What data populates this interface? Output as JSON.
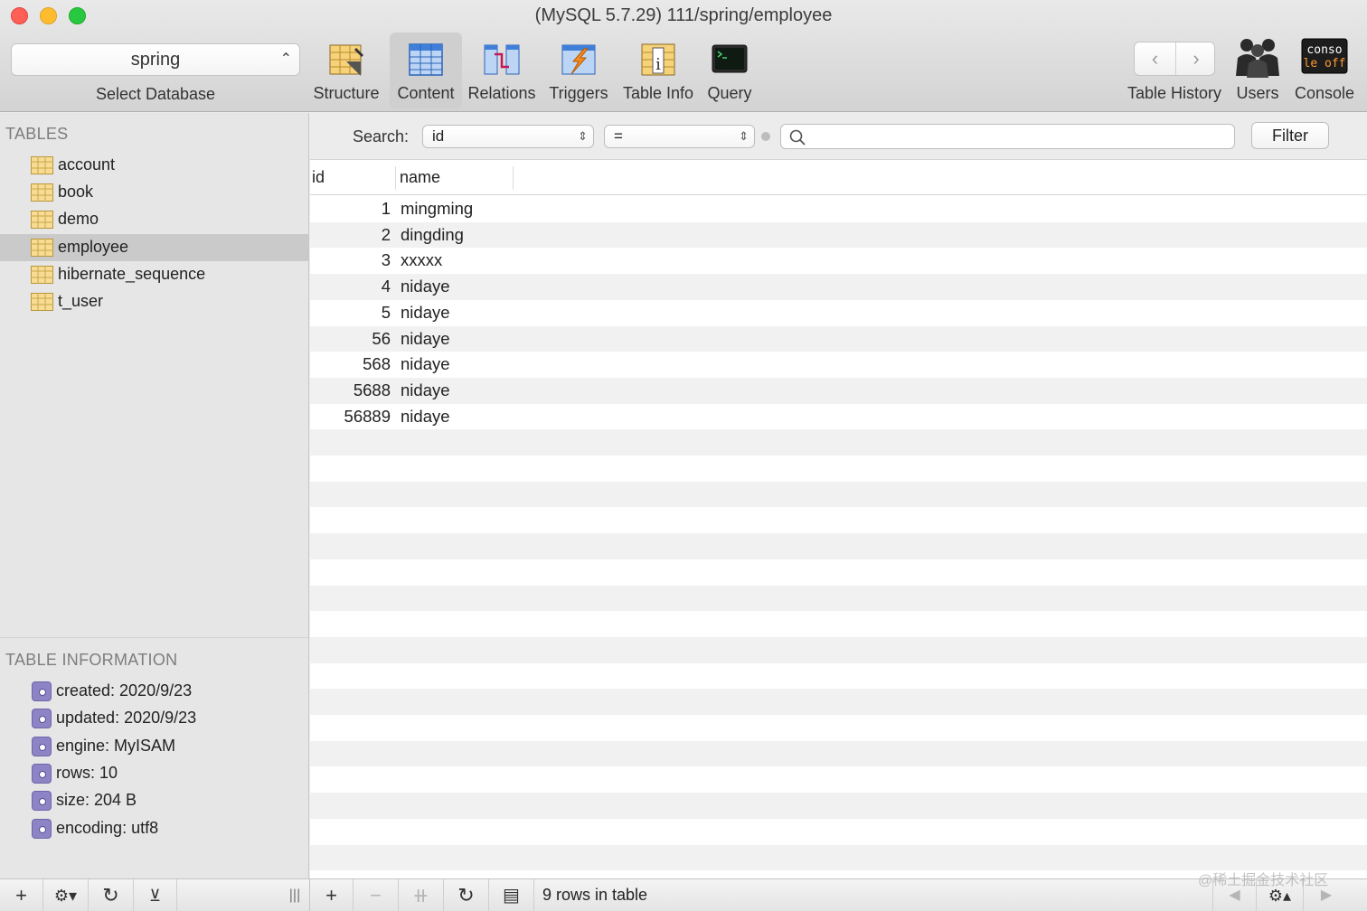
{
  "window": {
    "title": "(MySQL 5.7.29) 111/spring/employee"
  },
  "database": {
    "selected": "spring",
    "caption": "Select Database"
  },
  "toolbar": {
    "items": [
      {
        "label": "Structure",
        "icon": "structure-icon"
      },
      {
        "label": "Content",
        "icon": "content-icon",
        "active": true
      },
      {
        "label": "Relations",
        "icon": "relations-icon"
      },
      {
        "label": "Triggers",
        "icon": "triggers-icon"
      },
      {
        "label": "Table Info",
        "icon": "table-info-icon"
      },
      {
        "label": "Query",
        "icon": "query-icon"
      }
    ],
    "right": [
      {
        "label": "Table History",
        "icon": "back-forward-icon"
      },
      {
        "label": "Users",
        "icon": "users-icon"
      },
      {
        "label": "Console",
        "icon": "console-icon",
        "icon_text": [
          "conso",
          "le off"
        ]
      }
    ]
  },
  "sidebar": {
    "tables_heading": "TABLES",
    "tables": [
      "account",
      "book",
      "demo",
      "employee",
      "hibernate_sequence",
      "t_user"
    ],
    "selected_table": "employee",
    "info_heading": "TABLE INFORMATION",
    "info": [
      "created: 2020/9/23",
      "updated: 2020/9/23",
      "engine: MyISAM",
      "rows: 10",
      "size: 204 B",
      "encoding: utf8"
    ]
  },
  "search": {
    "label": "Search:",
    "field": "id",
    "operator": "=",
    "query": "",
    "filter_label": "Filter"
  },
  "grid": {
    "columns": [
      "id",
      "name"
    ],
    "rows": [
      [
        "1",
        "mingming"
      ],
      [
        "2",
        "dingding"
      ],
      [
        "3",
        "xxxxx"
      ],
      [
        "4",
        "nidaye"
      ],
      [
        "5",
        "nidaye"
      ],
      [
        "56",
        "nidaye"
      ],
      [
        "568",
        "nidaye"
      ],
      [
        "5688",
        "nidaye"
      ],
      [
        "56889",
        "nidaye"
      ]
    ]
  },
  "status": {
    "text": "9 rows in table"
  },
  "watermark": "@稀土掘金技术社区",
  "colors": {
    "selection": "#cacaca",
    "alt_row": "#f1f1f1",
    "info_icon": "#8d84c6"
  }
}
